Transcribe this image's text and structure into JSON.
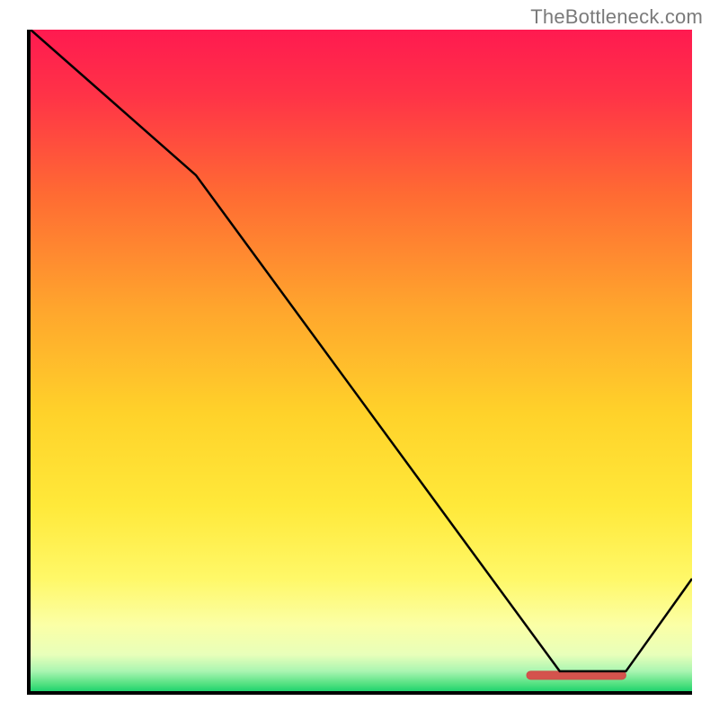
{
  "attribution": "TheBottleneck.com",
  "chart_data": {
    "type": "line",
    "title": "",
    "xlabel": "",
    "ylabel": "",
    "xlim": [
      0,
      100
    ],
    "ylim": [
      0,
      100
    ],
    "x": [
      0,
      25,
      80,
      90,
      100
    ],
    "values": [
      100,
      78,
      3,
      3,
      17
    ],
    "series_color": "#000000",
    "marker": {
      "x_start": 75,
      "x_end": 90,
      "y": 2.4,
      "color": "#d4534d",
      "stroke": "#cc4e48"
    },
    "background_gradient": {
      "top_pct": 0,
      "bottom_pct": 100,
      "stops": [
        {
          "offset": 0.0,
          "color": "#ff1a50"
        },
        {
          "offset": 0.1,
          "color": "#ff3347"
        },
        {
          "offset": 0.25,
          "color": "#ff6b33"
        },
        {
          "offset": 0.42,
          "color": "#ffa52d"
        },
        {
          "offset": 0.58,
          "color": "#ffd22a"
        },
        {
          "offset": 0.72,
          "color": "#ffe93a"
        },
        {
          "offset": 0.83,
          "color": "#fff868"
        },
        {
          "offset": 0.9,
          "color": "#fbffa6"
        },
        {
          "offset": 0.945,
          "color": "#e8ffba"
        },
        {
          "offset": 0.97,
          "color": "#a9f5b1"
        },
        {
          "offset": 0.99,
          "color": "#4fe07f"
        },
        {
          "offset": 1.0,
          "color": "#1fd36f"
        }
      ]
    },
    "axes": {
      "show_ticks": false,
      "axis_color": "#000000",
      "axis_width": 4
    }
  }
}
